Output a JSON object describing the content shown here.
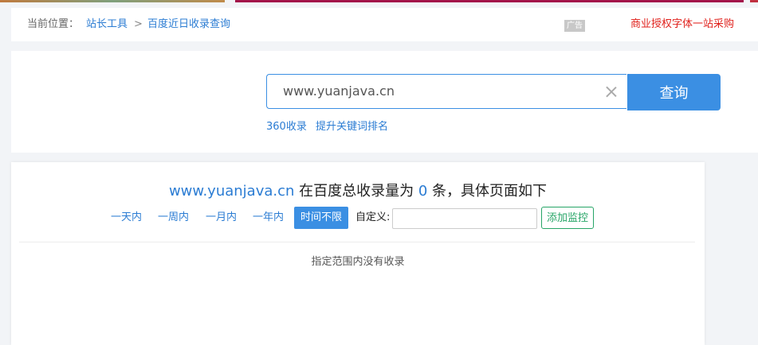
{
  "breadcrumb": {
    "label": "当前位置：",
    "links": [
      "站长工具",
      "百度近日收录查询"
    ],
    "separator": ">"
  },
  "ad": {
    "tag": "广告",
    "link": "商业授权字体一站采购"
  },
  "search": {
    "value": "www.yuanjava.cn",
    "button": "查询",
    "quick_links": [
      "360收录",
      "提升关键词排名"
    ]
  },
  "result": {
    "domain": "www.yuanjava.cn",
    "text_before": " 在百度总收录量为 ",
    "count": "0",
    "text_after": " 条，具体页面如下",
    "filters": [
      "一天内",
      "一周内",
      "一月内",
      "一年内",
      "时间不限"
    ],
    "active_filter": "时间不限",
    "custom_label": "自定义:",
    "monitor_button": "添加监控",
    "empty_message": "指定范围内没有收录"
  },
  "colors": {
    "accent": "#3b8fe3",
    "link": "#2b7cd3",
    "promo": "#e0211c",
    "monitor": "#27a567"
  }
}
